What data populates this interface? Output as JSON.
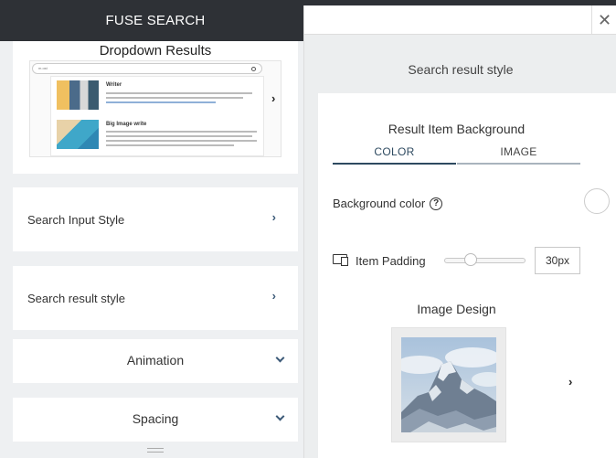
{
  "app": {
    "title": "FUSE SEARCH"
  },
  "preview": {
    "title": "Dropdown Results",
    "search_value": "m.ost",
    "items": [
      {
        "heading": "Writer"
      },
      {
        "heading": "Big Image write"
      }
    ]
  },
  "sections": [
    {
      "label": "Search Input Style"
    },
    {
      "label": "Search result style"
    },
    {
      "label": "Animation"
    },
    {
      "label": "Spacing"
    }
  ],
  "panel": {
    "title": "Search result style",
    "result_item_background": {
      "title": "Result Item Background",
      "tabs": [
        {
          "label": "COLOR"
        },
        {
          "label": "IMAGE"
        }
      ],
      "active_tab": "COLOR"
    },
    "background_color": {
      "label": "Background color",
      "value": "#ffffff"
    },
    "item_padding": {
      "label": "Item Padding",
      "value": "30px",
      "slider_fraction": 0.3
    },
    "image_design": {
      "title": "Image Design"
    }
  },
  "colors": {
    "topbar": "#2e3136",
    "accent": "#2e4a60",
    "chevron": "#3c5a78"
  },
  "icons": {
    "close": "close-icon",
    "help": "help-icon",
    "device": "device-icon",
    "chevron_right": "chevron-right-icon",
    "chevron_down": "chevron-down-icon"
  }
}
